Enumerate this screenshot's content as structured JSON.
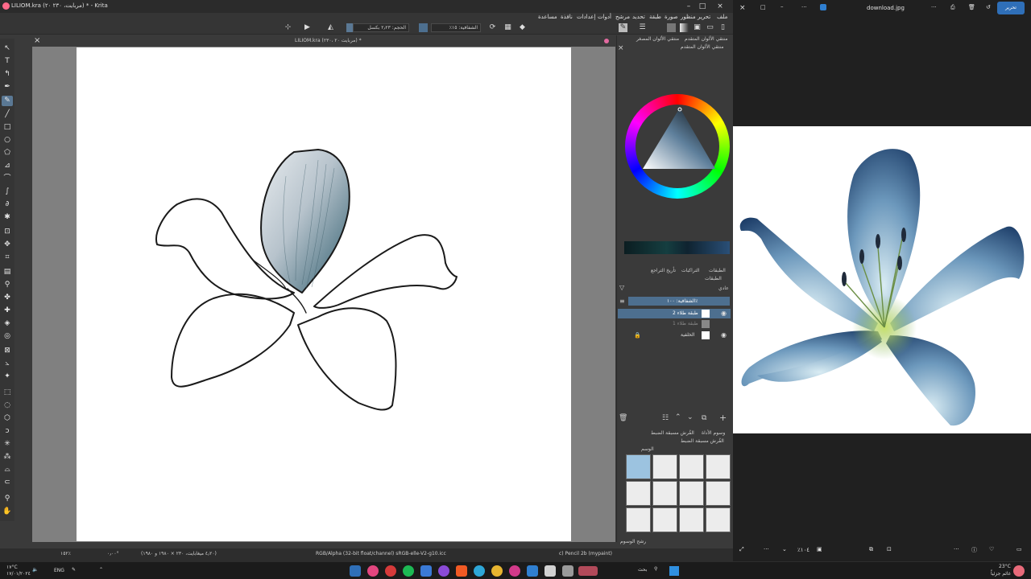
{
  "krita": {
    "title": "LILIOM.kra (۲۰ مربایت، ۲۳۰) * - Krita",
    "doc_tab": "LILIOM.kra (۲۳۰، ۲۰ مربایت) *",
    "menu": [
      "ملف",
      "تحرير",
      "منظور",
      "صورة",
      "طبقة",
      "تحديد",
      "مرشح",
      "أدوات",
      "إعدادات",
      "نافذة",
      "مساعدة"
    ],
    "toolbar": {
      "size_label": "الحجم: ٢٫٢٣ بكسل",
      "opacity_label": "الشفافية: ١٥٪"
    },
    "dockers": {
      "color_tabs": [
        "منتقي الألوان المتقدم",
        "منتقي الألوان المصغر"
      ],
      "color_subtitle": "منتقي الألوان المتقدم",
      "layers_tabs": [
        "الطبقات",
        "التراكبات",
        "تأريخ التراجع"
      ],
      "layers_title": "الطبقات",
      "blend_mode": "عادي",
      "opacity": "الشفافية: ١٠٠٪",
      "layers": [
        {
          "name": "طبقة طلاء 2",
          "selected": true
        },
        {
          "name": "طبقة طلاء 1",
          "selected": false
        },
        {
          "name": "الخلفية",
          "selected": false
        }
      ],
      "presets_tabs": [
        "وسوم الأداة",
        "الفُرش مسبقة الضبط"
      ],
      "presets_title": "الفُرش مسبقة الضبط",
      "tag_label": "الوسم",
      "filter_label": "رشح الوسوم"
    },
    "status": {
      "zoom": "١٥٢٪",
      "rotation": "٠٫٠٠°",
      "dimensions": "(٤٫٢٠ ميغابايت، ٢٣٠ × ١٩٨٠ و ١٩٨٠)",
      "color_space": "RGB/Alpha (32-bit float/channel)  sRGB-elle-V2-g10.icc",
      "brush": "c) Pencil 2b (mypaint)"
    }
  },
  "photos": {
    "title": "download.jpg",
    "edit_button": "تحرير",
    "zoom": "٪١٠٤"
  },
  "taskbar": {
    "weather_temp": "١٧°C",
    "weather_date": "١٧/٠١/٢٠٢٤",
    "lang": "ENG",
    "search": "بحث",
    "clock_temp": "23°C",
    "clock_label": "غائم جزئياً"
  },
  "colors": {
    "accent": "#5a7894",
    "active_layer": "#4d6f8f",
    "lily_blue": "#2f5d8a"
  }
}
